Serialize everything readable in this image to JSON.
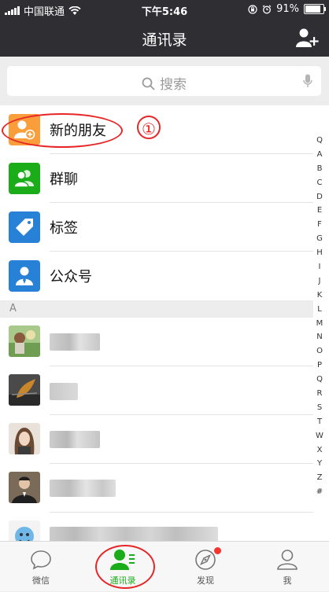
{
  "status_bar": {
    "carrier": "中国联通",
    "time": "下午5:46",
    "battery": "91%",
    "battery_fraction": 0.91
  },
  "nav": {
    "title": "通讯录"
  },
  "search": {
    "placeholder": "搜索"
  },
  "function_items": [
    {
      "label": "新的朋友",
      "icon": "add-friend-icon",
      "color": "#fa9d3b"
    },
    {
      "label": "群聊",
      "icon": "group-chat-icon",
      "color": "#1aad19"
    },
    {
      "label": "标签",
      "icon": "tag-icon",
      "color": "#2782d7"
    },
    {
      "label": "公众号",
      "icon": "official-account-icon",
      "color": "#2782d7"
    }
  ],
  "section_header": "A",
  "annotation": "①",
  "index_letters": [
    "Q",
    "A",
    "B",
    "C",
    "D",
    "E",
    "F",
    "G",
    "H",
    "I",
    "J",
    "K",
    "L",
    "M",
    "N",
    "O",
    "P",
    "Q",
    "R",
    "S",
    "T",
    "W",
    "X",
    "Y",
    "Z",
    "#"
  ],
  "tabs": [
    {
      "label": "微信",
      "icon": "chat-bubble-icon"
    },
    {
      "label": "通讯录",
      "icon": "contacts-icon",
      "active": true
    },
    {
      "label": "发现",
      "icon": "compass-icon",
      "badge_dot": true
    },
    {
      "label": "我",
      "icon": "profile-icon"
    }
  ],
  "colors": {
    "nav_bg": "#2e2e33",
    "accent_green": "#1aad19",
    "annotation_red": "#e62626"
  }
}
